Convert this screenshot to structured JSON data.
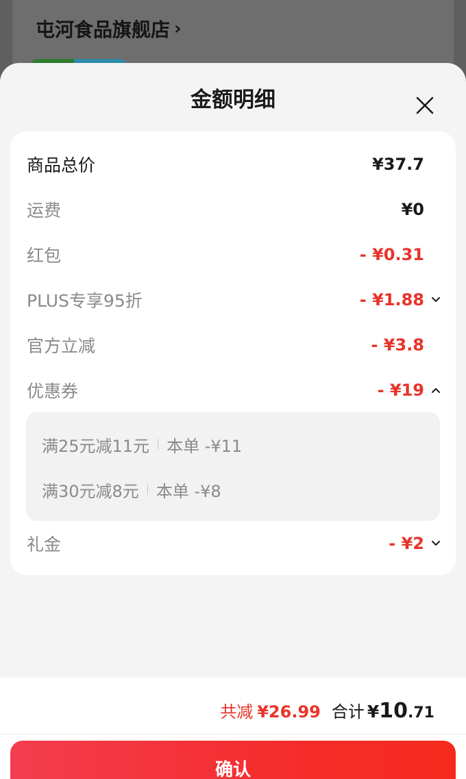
{
  "background": {
    "store_name": "屯河食品旗舰店"
  },
  "sheet": {
    "title": "金额明细"
  },
  "rows": [
    {
      "label": "商品总价",
      "value": "¥37.7"
    },
    {
      "label": "运费",
      "value": "¥0"
    },
    {
      "label": "红包",
      "value": "- ¥0.31"
    },
    {
      "label": "PLUS专享95折",
      "value": "- ¥1.88"
    },
    {
      "label": "官方立减",
      "value": "- ¥3.8"
    },
    {
      "label": "优惠券",
      "value": "- ¥19"
    },
    {
      "label": "礼金",
      "value": "- ¥2"
    }
  ],
  "coupons": [
    {
      "condition": "满25元减11元",
      "amount": "本单 -¥11"
    },
    {
      "condition": "满30元减8元",
      "amount": "本单 -¥8"
    }
  ],
  "footer": {
    "saved_label": "共减",
    "saved_amount": "¥26.99",
    "total_label": "合计",
    "total_currency": "¥",
    "total_integer": "10",
    "total_decimal": ".71",
    "confirm_label": "确认"
  },
  "colors": {
    "accent_red": "#e8342a",
    "button_gradient_start": "#f33d4e",
    "button_gradient_end": "#f6291c"
  }
}
